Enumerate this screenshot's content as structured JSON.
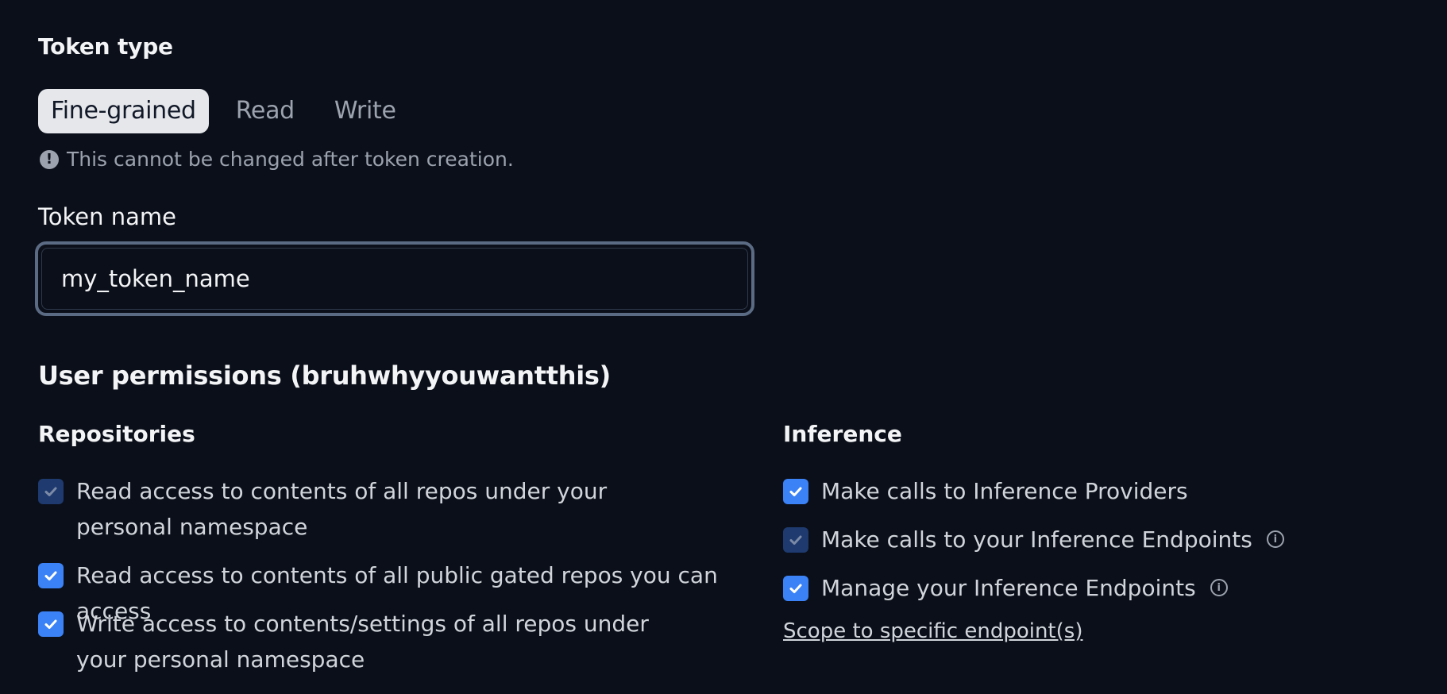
{
  "token_type": {
    "label": "Token type",
    "tabs": [
      "Fine-grained",
      "Read",
      "Write"
    ],
    "selected": "Fine-grained",
    "notice": "This cannot be changed after token creation."
  },
  "token_name": {
    "label": "Token name",
    "value": "my_token_name"
  },
  "permissions": {
    "title": "User permissions (bruhwhyyouwantthis)",
    "repositories": {
      "title": "Repositories",
      "items": [
        {
          "label": "Read access to contents of all repos under your personal namespace",
          "checked": true,
          "disabled": true
        },
        {
          "label": "Read access to contents of all public gated repos you can access",
          "checked": true,
          "disabled": false
        },
        {
          "label": "Write access to contents/settings of all repos under your personal namespace",
          "checked": true,
          "disabled": false
        }
      ]
    },
    "inference": {
      "title": "Inference",
      "items": [
        {
          "label": "Make calls to Inference Providers",
          "checked": true,
          "disabled": false
        },
        {
          "label": "Make calls to your Inference Endpoints",
          "checked": true,
          "disabled": true
        },
        {
          "label": "Manage your Inference Endpoints",
          "checked": true,
          "disabled": false
        }
      ],
      "scope_link": "Scope to specific endpoint(s)"
    }
  },
  "colors": {
    "background": "#0b0f19",
    "checkbox_active": "#3b82f6",
    "checkbox_disabled": "#1e3a6e",
    "tab_active_bg": "#e5e7eb"
  }
}
